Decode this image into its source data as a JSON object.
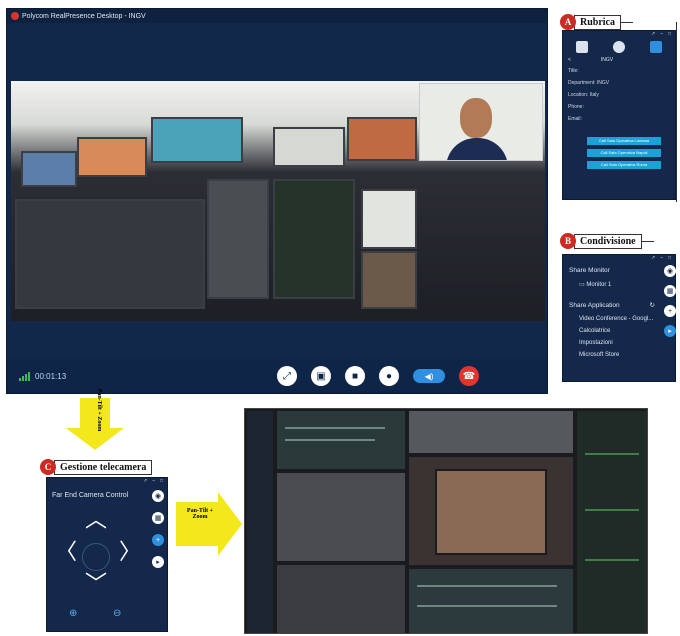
{
  "main_window": {
    "title": "Polycom RealPresence Desktop - INGV",
    "timer": "00:01:13"
  },
  "callouts": {
    "a": {
      "letter": "A",
      "label": "Rubrica"
    },
    "b": {
      "letter": "B",
      "label": "Condivisione"
    },
    "c": {
      "letter": "C",
      "label": "Gestione telecamera"
    }
  },
  "rubrica": {
    "contact_back": "<",
    "contact_name": "INGV",
    "fields": [
      "Title:",
      "Department: INGV",
      "Location: Italy",
      "Phone:",
      "Email:"
    ],
    "buttons": [
      "Call Sala Operativa Lontana",
      "Call Sala Operativa Napoli",
      "Call Sala Operativa Roma"
    ]
  },
  "condivisione": {
    "share_monitor": "Share Monitor",
    "monitor_item": "Monitor 1",
    "share_application": "Share Application",
    "apps": [
      "Video Conference - Googl...",
      "Calcolatrice",
      "Impostazioni",
      "Microsoft Store"
    ]
  },
  "camera_control": {
    "title": "Far End Camera Control"
  },
  "arrows": {
    "down_label": "Pan-Tilt + Zoom",
    "right_label": "Pan-Tilt + Zoom"
  },
  "colors": {
    "panel_bg": "#13284a",
    "accent_blue": "#2f8fe0",
    "end_call_red": "#e3342e",
    "callout_red": "#cc2a23",
    "arrow_yellow": "#f2e81b"
  }
}
